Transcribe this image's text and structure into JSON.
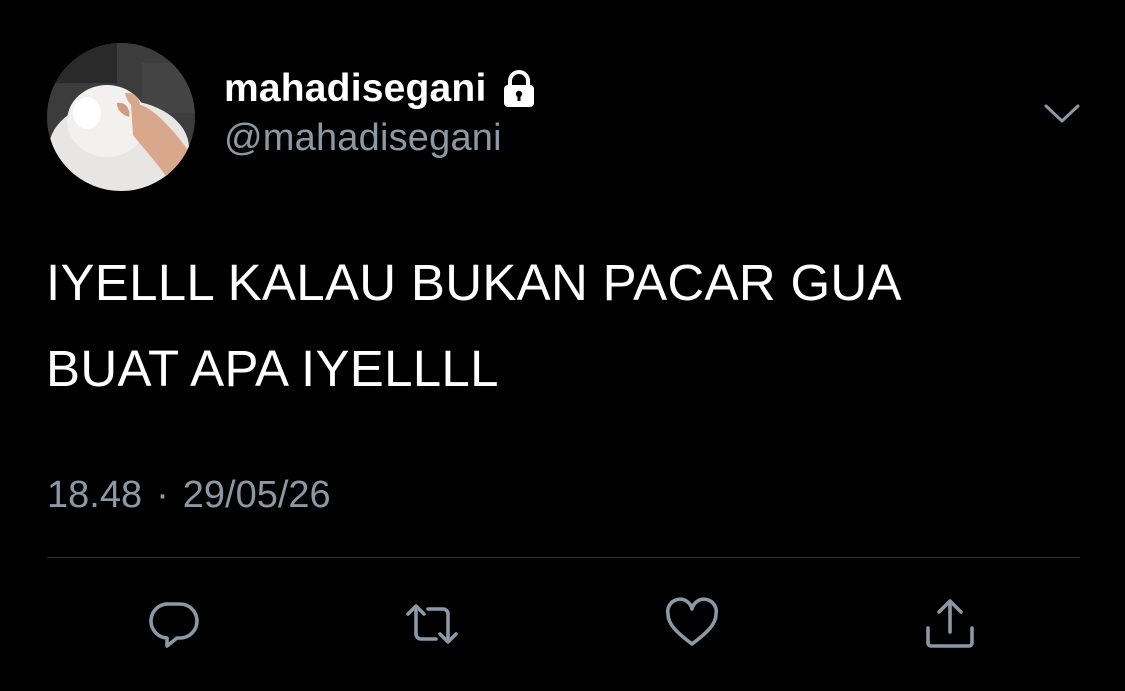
{
  "user": {
    "display_name": "mahadisegani",
    "handle": "@mahadisegani",
    "avatar": "avatar-image",
    "protected_icon": "lock-icon"
  },
  "tweet": {
    "text": "IYELLL KALAU BUKAN PACAR GUA\nBUAT APA IYELLLL",
    "time": "18.48",
    "separator": "·",
    "date": "29/05/26"
  },
  "header": {
    "menu_icon": "chevron-down-icon"
  },
  "actions": [
    {
      "name": "reply",
      "icon": "reply-icon"
    },
    {
      "name": "retweet",
      "icon": "retweet-icon"
    },
    {
      "name": "like",
      "icon": "heart-icon"
    },
    {
      "name": "share",
      "icon": "share-icon"
    }
  ],
  "colors": {
    "background": "#000000",
    "text": "#ffffff",
    "secondary": "#8b98a5",
    "divider": "#2f3336"
  }
}
